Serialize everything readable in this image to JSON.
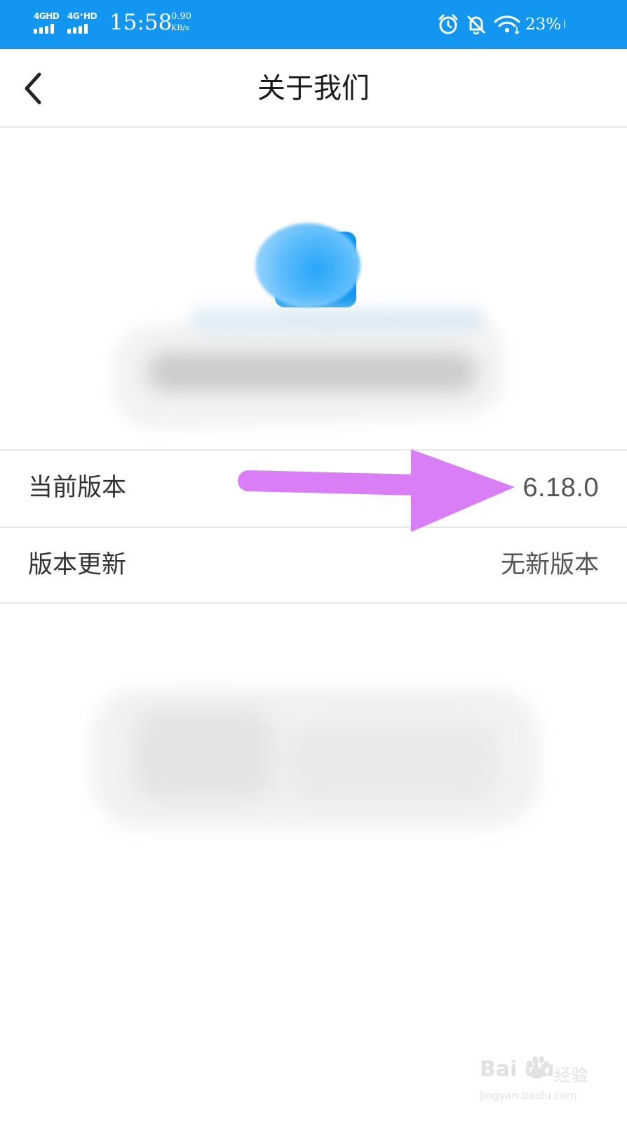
{
  "status_bar": {
    "sim1": "4GHD",
    "sim2": "4G⁺HD",
    "time": "15:58",
    "net_speed_value": "0.90",
    "net_speed_unit": "KB/s",
    "battery_percent": "23%"
  },
  "header": {
    "title": "关于我们"
  },
  "rows": {
    "current_version": {
      "label": "当前版本",
      "value": "6.18.0"
    },
    "version_update": {
      "label": "版本更新",
      "value": "无新版本"
    }
  },
  "watermark": {
    "logo_text": "Bai du",
    "cn_text": "经验",
    "url": "jingyan.baidu.com"
  },
  "colors": {
    "status_bar_bg": "#1296f0",
    "annotation_arrow": "#d97ef5",
    "logo_blue": "#1196ee"
  }
}
